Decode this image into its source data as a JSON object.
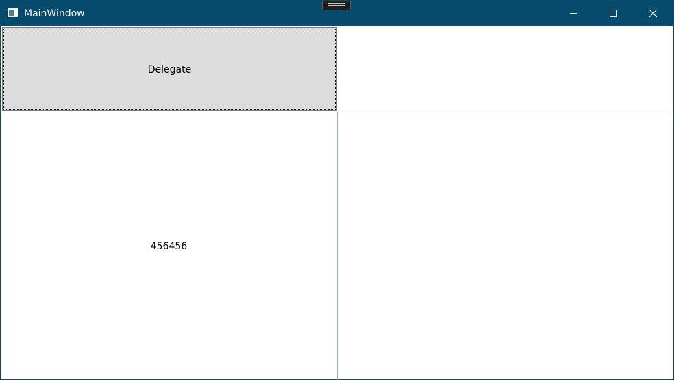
{
  "window": {
    "title": "MainWindow"
  },
  "title_bar": {
    "app_icon": "window-app-icon",
    "controls": [
      {
        "name": "minimize",
        "icon": "minimize-icon"
      },
      {
        "name": "maximize",
        "icon": "maximize-icon"
      },
      {
        "name": "close",
        "icon": "close-icon"
      }
    ],
    "background_color": "#064a6e"
  },
  "content": {
    "delegate_button_label": "Delegate",
    "value_text": "456456"
  }
}
